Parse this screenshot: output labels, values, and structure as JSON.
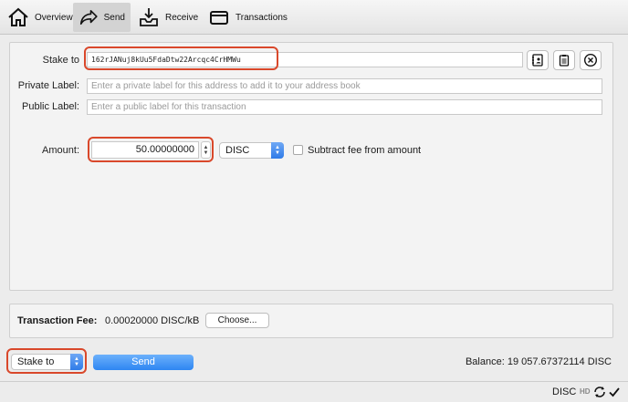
{
  "toolbar": {
    "items": [
      {
        "label": "Overview",
        "icon": "home-icon"
      },
      {
        "label": "Send",
        "icon": "send-arrow-icon",
        "active": true
      },
      {
        "label": "Receive",
        "icon": "inbox-download-icon"
      },
      {
        "label": "Transactions",
        "icon": "card-icon"
      }
    ]
  },
  "form": {
    "stake_to_label": "Stake to",
    "stake_to_value": "162rJANuj8kUu5FdaDtw22Arcqc4CrHMWu",
    "private_label_label": "Private Label:",
    "private_label_placeholder": "Enter a private label for this address to add it to your address book",
    "public_label_label": "Public Label:",
    "public_label_placeholder": "Enter a public label for this transaction",
    "amount_label": "Amount:",
    "amount_value": "50.00000000",
    "unit": "DISC",
    "subtract_fee_label": "Subtract fee from amount",
    "subtract_fee_checked": false
  },
  "fee": {
    "label": "Transaction Fee:",
    "value": "0.00020000 DISC/kB",
    "choose_label": "Choose..."
  },
  "footer": {
    "mode": "Stake to",
    "send_label": "Send",
    "balance": "Balance: 19 057.67372114 DISC"
  },
  "statusbar": {
    "unit": "DISC",
    "hd": "HD"
  },
  "colors": {
    "highlight": "#d9482b",
    "accent": "#2e86f2"
  }
}
